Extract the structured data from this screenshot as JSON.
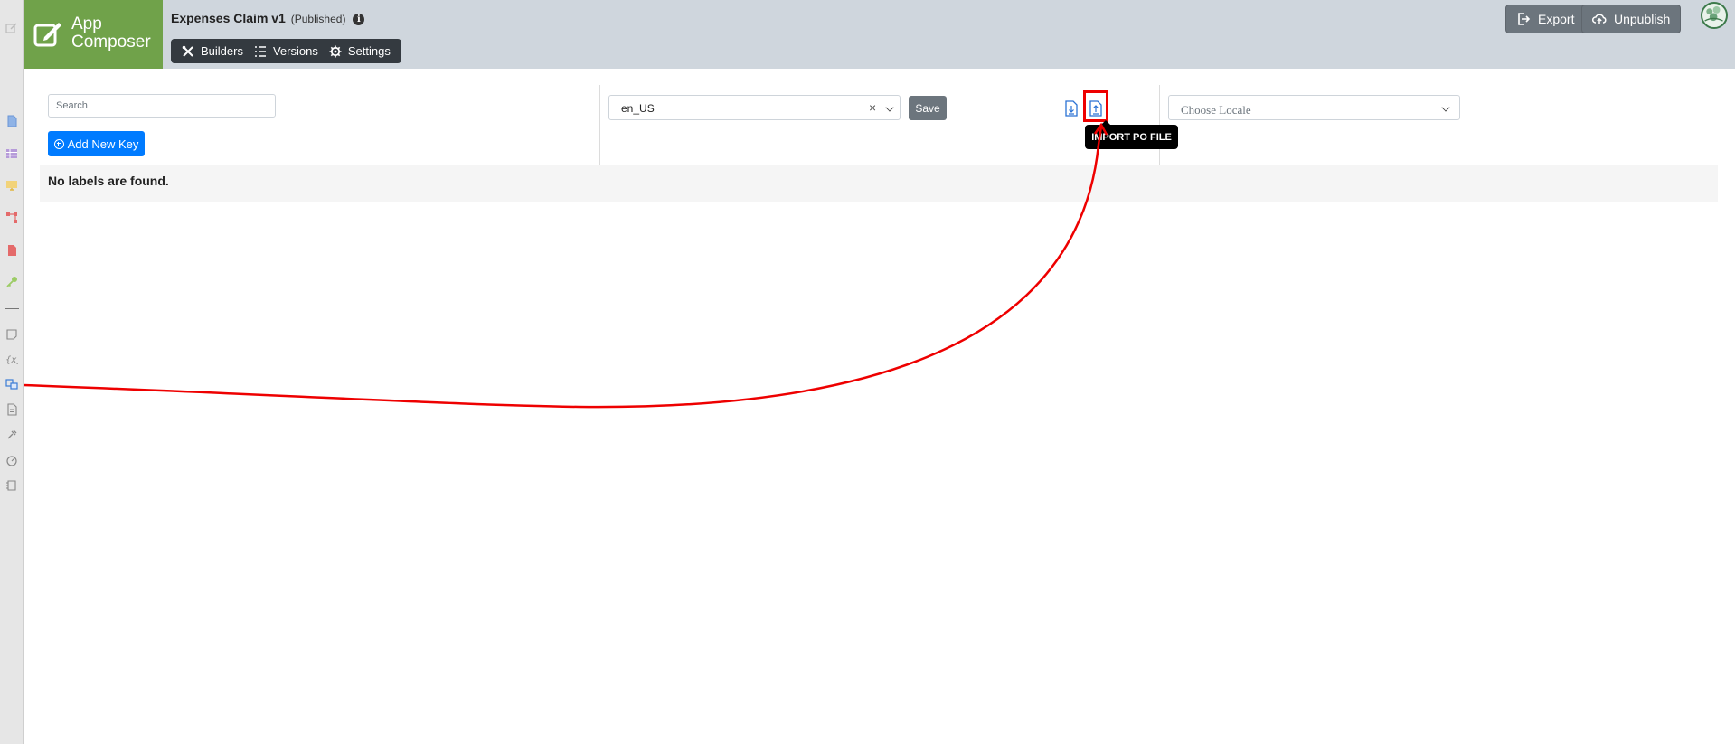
{
  "header": {
    "brand_line1": "App",
    "brand_line2": "Composer",
    "app_name": "Expenses Claim v1",
    "app_status": "(Published)",
    "info_glyph": "i",
    "tabs": [
      {
        "label": "Builders",
        "icon": "tools-icon"
      },
      {
        "label": "Versions",
        "icon": "list-icon"
      },
      {
        "label": "Settings",
        "icon": "gear-icon"
      }
    ],
    "export_label": "Export",
    "unpublish_label": "Unpublish"
  },
  "sidebar": {
    "icons": [
      "edit-icon",
      "form-icon",
      "datalist-icon",
      "userview-icon",
      "process-icon",
      "pdf-icon",
      "key-icon",
      "note-icon",
      "variable-icon",
      "i18n-icon",
      "document-icon",
      "plugin-icon",
      "performance-icon",
      "log-icon"
    ]
  },
  "main": {
    "search_placeholder": "Search",
    "add_key_label": "Add New Key",
    "locale_value": "en_US",
    "clear_glyph": "×",
    "save_label": "Save",
    "export_po_icon": "file-export-icon",
    "import_po_icon": "file-import-icon",
    "tooltip": "IMPORT PO FILE",
    "choose_locale_placeholder": "Choose Locale",
    "empty_message": "No labels are found."
  },
  "colors": {
    "brand": "#70a24a",
    "header_bg": "#cfd6dd",
    "primary": "#007bff",
    "secondary": "#6c757d",
    "annotation": "#ee0000"
  }
}
